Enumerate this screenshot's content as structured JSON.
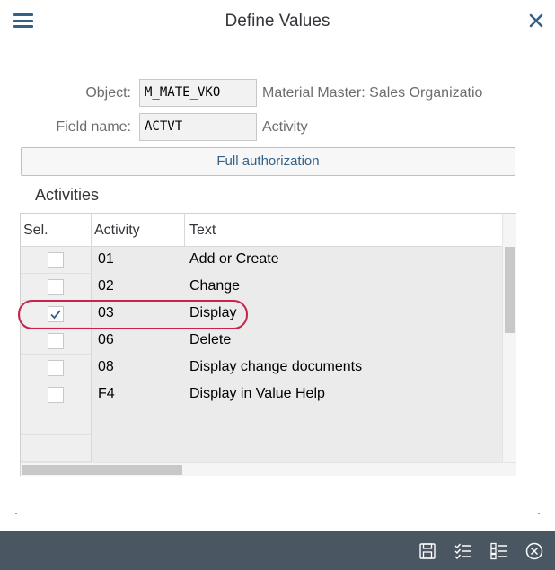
{
  "dialog": {
    "title": "Define Values"
  },
  "icons": {
    "menu": "hamburger-menu-icon",
    "close": "close-icon",
    "save": "save-icon",
    "select_all": "select-all-icon",
    "deselect_all": "deselect-all-icon",
    "cancel": "cancel-circle-icon"
  },
  "form": {
    "object_label": "Object:",
    "object_value": "M_MATE_VKO",
    "object_desc": "Material Master: Sales Organizatio",
    "field_label": "Field name:",
    "field_value": "ACTVT",
    "field_desc": "Activity"
  },
  "full_auth_label": "Full authorization",
  "section_title": "Activities",
  "table": {
    "headers": [
      "Sel.",
      "Activity",
      "Text"
    ],
    "rows": [
      {
        "checked": false,
        "activity": "01",
        "text": "Add or Create"
      },
      {
        "checked": false,
        "activity": "02",
        "text": "Change"
      },
      {
        "checked": true,
        "activity": "03",
        "text": "Display"
      },
      {
        "checked": false,
        "activity": "06",
        "text": "Delete"
      },
      {
        "checked": false,
        "activity": "08",
        "text": "Display change documents"
      },
      {
        "checked": false,
        "activity": "F4",
        "text": "Display in Value Help"
      }
    ]
  },
  "colors": {
    "accent": "#346187",
    "footer_bg": "#4b5663",
    "highlight": "#c8234b",
    "checkmark": "#346187"
  }
}
